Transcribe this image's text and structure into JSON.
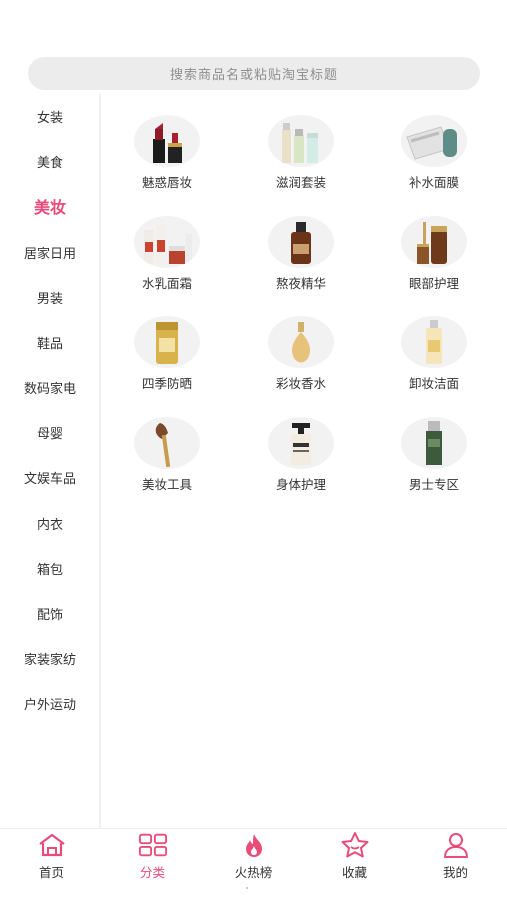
{
  "search": {
    "placeholder": "搜索商品名或粘贴淘宝标题"
  },
  "sidebar": {
    "items": [
      {
        "label": "女装"
      },
      {
        "label": "美食"
      },
      {
        "label": "美妆"
      },
      {
        "label": "居家日用"
      },
      {
        "label": "男装"
      },
      {
        "label": "鞋品"
      },
      {
        "label": "数码家电"
      },
      {
        "label": "母婴"
      },
      {
        "label": "文娱车品"
      },
      {
        "label": "内衣"
      },
      {
        "label": "箱包"
      },
      {
        "label": "配饰"
      },
      {
        "label": "家装家纺"
      },
      {
        "label": "户外运动"
      }
    ],
    "active_index": 2
  },
  "categories": [
    {
      "label": "魅惑唇妆",
      "icon": "lipstick-icon"
    },
    {
      "label": "滋润套装",
      "icon": "skincare-set-icon"
    },
    {
      "label": "补水面膜",
      "icon": "face-mask-icon"
    },
    {
      "label": "水乳面霜",
      "icon": "toner-cream-icon"
    },
    {
      "label": "熬夜精华",
      "icon": "serum-icon"
    },
    {
      "label": "眼部护理",
      "icon": "eye-care-icon"
    },
    {
      "label": "四季防晒",
      "icon": "sunscreen-icon"
    },
    {
      "label": "彩妆香水",
      "icon": "perfume-icon"
    },
    {
      "label": "卸妆洁面",
      "icon": "cleanser-icon"
    },
    {
      "label": "美妆工具",
      "icon": "makeup-brush-icon"
    },
    {
      "label": "身体护理",
      "icon": "body-lotion-icon"
    },
    {
      "label": "男士专区",
      "icon": "mens-product-icon"
    }
  ],
  "tabbar": {
    "items": [
      {
        "label": "首页",
        "icon": "home-icon"
      },
      {
        "label": "分类",
        "icon": "category-grid-icon"
      },
      {
        "label": "火热榜",
        "icon": "flame-icon"
      },
      {
        "label": "收藏",
        "icon": "star-icon"
      },
      {
        "label": "我的",
        "icon": "user-icon"
      }
    ],
    "active_index": 1
  },
  "colors": {
    "accent": "#ea4c7a",
    "text": "#333333",
    "search_bg": "#ececec"
  }
}
